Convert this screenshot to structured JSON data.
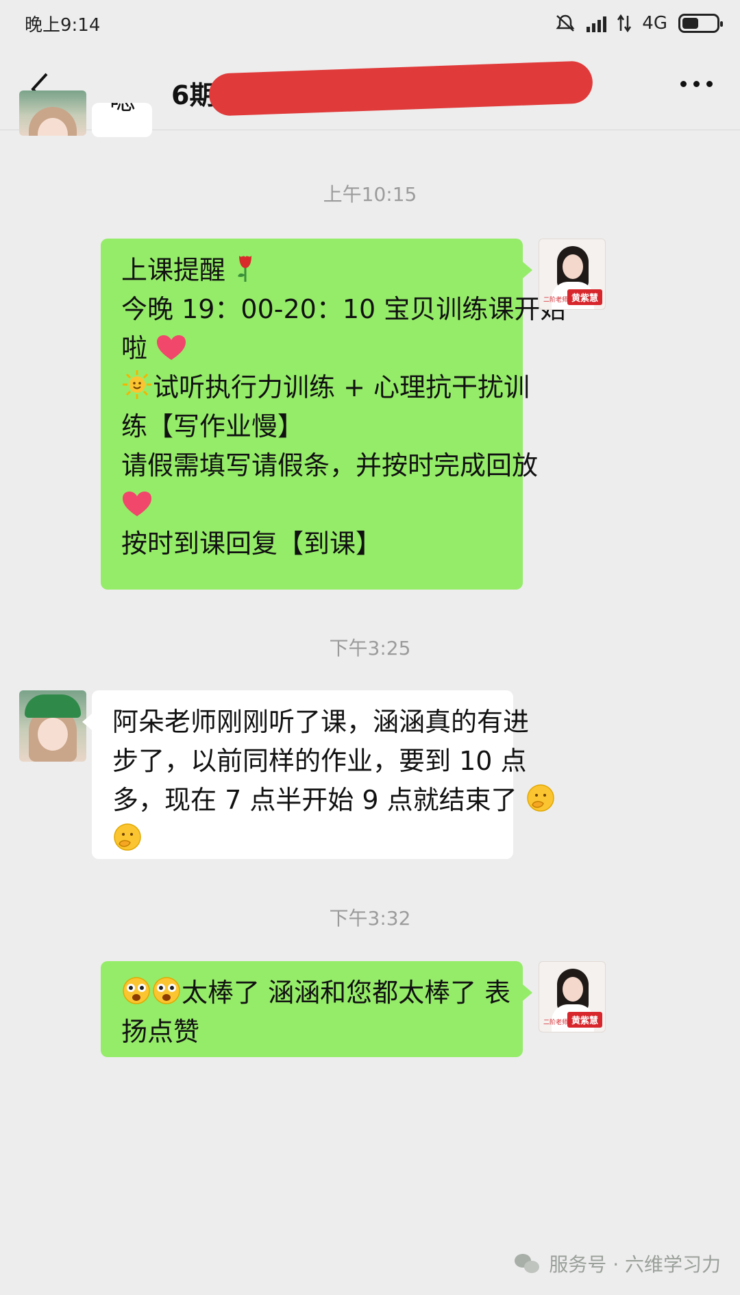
{
  "status_bar": {
    "time": "晚上9:14",
    "network": "4G"
  },
  "nav": {
    "title": "6期"
  },
  "messages": {
    "m0_text": "嗯",
    "ts1": "上午10:15",
    "m1_lines": [
      "上课提醒",
      "今晚 19：00-20：10 宝贝训练课开始",
      "啦",
      "试听执行力训练 + 心理抗干扰训",
      "练【写作业慢】",
      "请假需填写请假条，并按时完成回放",
      "按时到课回复【到课】"
    ],
    "ts2": "下午3:25",
    "m2_lines": [
      "阿朵老师刚刚听了课，涵涵真的有进",
      "步了，以前同样的作业，要到 10 点",
      "多，现在 7 点半开始 9 点就结束了"
    ],
    "ts3": "下午3:32",
    "m3_lines": [
      "太棒了  涵涵和您都太棒了  表",
      "扬点赞"
    ],
    "teacher_tag": "黄紫慧",
    "teacher_tag_small": "二阶老师"
  },
  "watermark": "服务号 · 六维学习力",
  "icons": [
    "back-icon",
    "more-icon",
    "mute-icon",
    "signal-icon",
    "battery-icon",
    "rose-icon",
    "heart-icon",
    "sun-icon",
    "thinking-face-icon",
    "star-eyes-icon",
    "wechat-icon"
  ]
}
